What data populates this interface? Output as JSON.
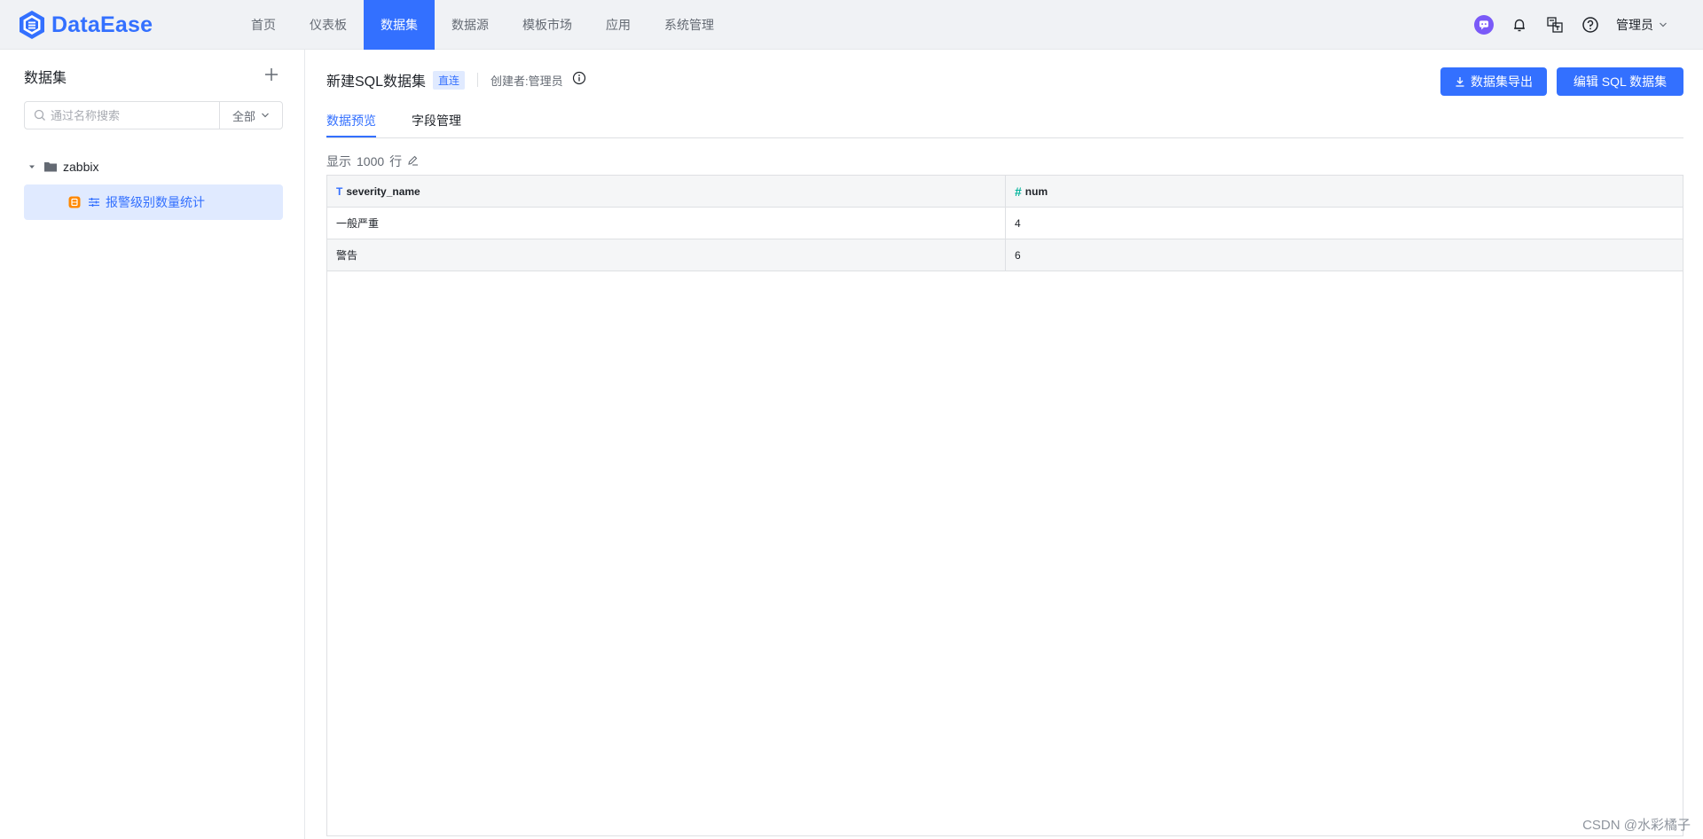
{
  "logo": {
    "text": "DataEase"
  },
  "nav": {
    "items": [
      {
        "label": "首页"
      },
      {
        "label": "仪表板"
      },
      {
        "label": "数据集"
      },
      {
        "label": "数据源"
      },
      {
        "label": "模板市场"
      },
      {
        "label": "应用"
      },
      {
        "label": "系统管理"
      }
    ],
    "active_index": 2
  },
  "user": {
    "name": "管理员"
  },
  "sidebar": {
    "title": "数据集",
    "search": {
      "placeholder": "通过名称搜索",
      "filter": "全部"
    },
    "tree": {
      "folder": "zabbix",
      "leaf": "报警级别数量统计"
    }
  },
  "dataset": {
    "title": "新建SQL数据集",
    "tag": "直连",
    "creator": "创建者:管理员",
    "export_label": "数据集导出",
    "edit_label": "编辑 SQL 数据集",
    "tabs": [
      {
        "label": "数据预览"
      },
      {
        "label": "字段管理"
      }
    ],
    "active_tab": 0,
    "row_count": {
      "prefix": "显示",
      "value": "1000",
      "suffix": "行"
    }
  },
  "table": {
    "columns": [
      {
        "name": "severity_name",
        "type_icon": "T"
      },
      {
        "name": "num",
        "type_icon": "#"
      }
    ],
    "rows": [
      [
        "一般严重",
        "4"
      ],
      [
        "警告",
        "6"
      ]
    ]
  },
  "watermark": "CSDN @水彩橘子",
  "colors": {
    "accent": "#3370ff",
    "active_bg": "#e0eaff",
    "text_type": "#3370ff",
    "num_type": "#04b49c"
  }
}
